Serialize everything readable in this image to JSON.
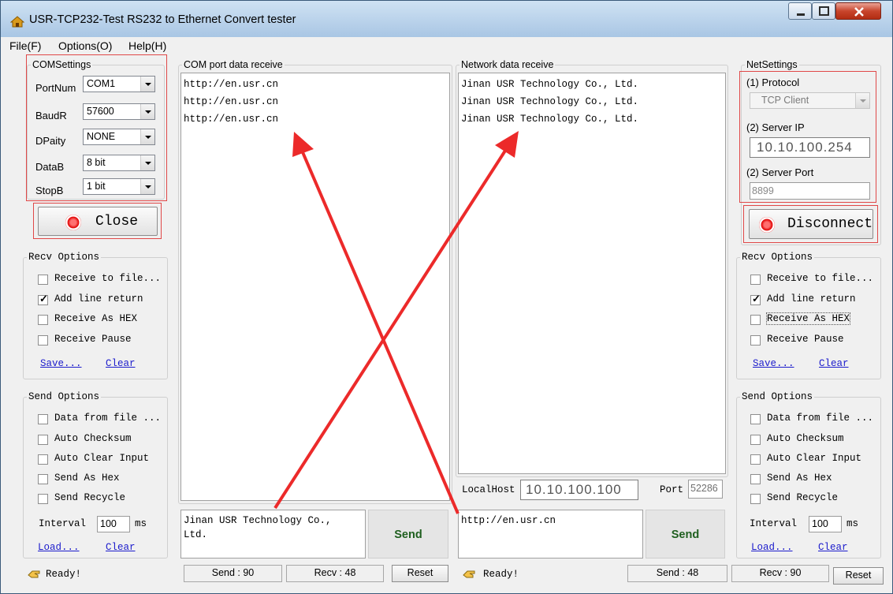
{
  "window": {
    "title": "USR-TCP232-Test  RS232 to Ethernet Convert tester"
  },
  "menu": [
    "File(F)",
    "Options(O)",
    "Help(H)"
  ],
  "com_settings": {
    "legend": "COMSettings",
    "fields": [
      {
        "label": "PortNum",
        "value": "COM1"
      },
      {
        "label": "BaudR",
        "value": "57600"
      },
      {
        "label": "DPaity",
        "value": "NONE"
      },
      {
        "label": "DataB",
        "value": "8 bit"
      },
      {
        "label": "StopB",
        "value": "1 bit"
      }
    ],
    "button": "Close"
  },
  "net_settings": {
    "legend": "NetSettings",
    "protocol_label": "(1) Protocol",
    "protocol_value": "TCP Client",
    "server_ip_label": "(2) Server IP",
    "server_ip": [
      "10",
      ".10",
      ".100",
      ".254"
    ],
    "server_port_label": "(2) Server Port",
    "server_port": "8899",
    "button": "Disconnect"
  },
  "com_receive": {
    "legend": "COM port data receive",
    "lines": [
      "http://en.usr.cn",
      "http://en.usr.cn",
      "http://en.usr.cn"
    ]
  },
  "net_receive": {
    "legend": "Network data receive",
    "lines": [
      "Jinan USR Technology Co., Ltd.",
      "Jinan USR Technology Co., Ltd.",
      "Jinan USR Technology Co., Ltd."
    ]
  },
  "recv_options": {
    "legend": "Recv Options",
    "items": [
      {
        "label": "Receive to file...",
        "checked": false
      },
      {
        "label": "Add line return",
        "checked": true
      },
      {
        "label": "Receive As HEX",
        "checked": false
      },
      {
        "label": "Receive Pause",
        "checked": false
      }
    ],
    "save": "Save...",
    "clear": "Clear"
  },
  "send_options": {
    "legend": "Send Options",
    "items": [
      {
        "label": "Data from file ...",
        "checked": false
      },
      {
        "label": "Auto Checksum",
        "checked": false
      },
      {
        "label": "Auto Clear Input",
        "checked": false
      },
      {
        "label": "Send As Hex",
        "checked": false
      },
      {
        "label": "Send Recycle",
        "checked": false
      }
    ],
    "interval_label": "Interval",
    "interval_value": "100",
    "interval_unit": "ms",
    "load": "Load...",
    "clear": "Clear"
  },
  "com_send": {
    "text1": "Jinan USR Technology Co.,",
    "text2": "Ltd.",
    "button": "Send"
  },
  "net_send": {
    "text": "http://en.usr.cn",
    "button": "Send"
  },
  "localhost": {
    "label": "LocalHost",
    "ip": [
      "10",
      ".10",
      ".100",
      ".100"
    ],
    "port_label": "Port",
    "port": "52286"
  },
  "status_left": {
    "text": "Ready!",
    "send": "Send : 90",
    "recv": "Recv : 48",
    "reset": "Reset"
  },
  "status_right": {
    "text": "Ready!",
    "send": "Send : 48",
    "recv": "Recv : 90",
    "reset": "Reset"
  },
  "colors": {
    "accent_red": "#e83030",
    "send_green": "#1f5f1f"
  }
}
